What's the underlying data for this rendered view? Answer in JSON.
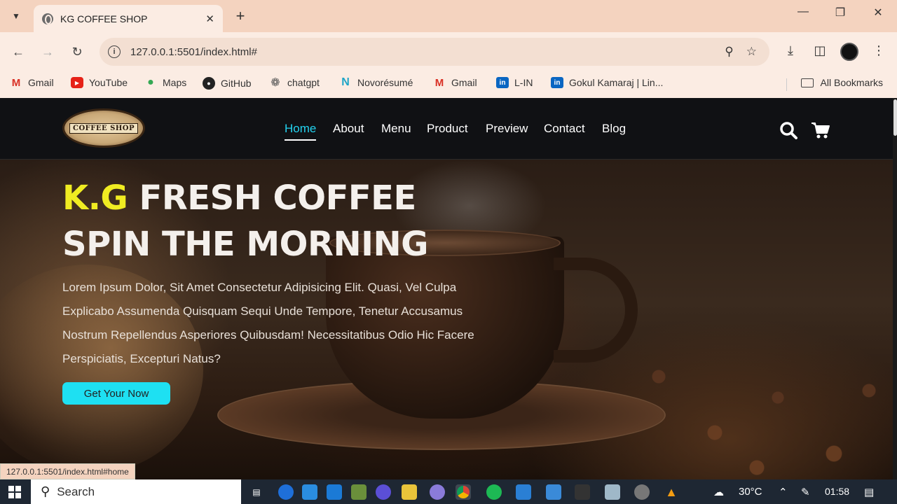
{
  "browser": {
    "tab_title": "KG COFFEE SHOP",
    "url": "127.0.0.1:5501/index.html#",
    "status_url": "127.0.0.1:5501/index.html#home",
    "bookmarks": [
      "Gmail",
      "YouTube",
      "Maps",
      "GitHub",
      "chatgpt",
      "Novorésumé",
      "Gmail",
      "L-IN",
      "Gokul Kamaraj | Lin..."
    ],
    "all_bookmarks": "All Bookmarks"
  },
  "site": {
    "logo_text": "COFFEE SHOP",
    "nav": [
      "Home",
      "About",
      "Menu",
      "Product",
      "Preview",
      "Contact",
      "Blog"
    ],
    "active_nav": "Home",
    "hero": {
      "title_highlight": "K.G",
      "title_line1_rest": "FRESH COFFEE",
      "title_line2": "SPIN THE MORNING",
      "paragraph": "Lorem Ipsum Dolor, Sit Amet Consectetur Adipisicing Elit. Quasi, Vel Culpa Explicabo Assumenda Quisquam Sequi Unde Tempore, Tenetur Accusamus Nostrum Repellendus Asperiores Quibusdam! Necessitatibus Odio Hic Facere Perspiciatis, Excepturi Natus?",
      "cta_label": "Get Your Now"
    },
    "accent_color": "#1ee0f2",
    "highlight_color": "#f0ec22"
  },
  "taskbar": {
    "search_label": "Search",
    "temperature": "30°C",
    "time": "01:58"
  }
}
